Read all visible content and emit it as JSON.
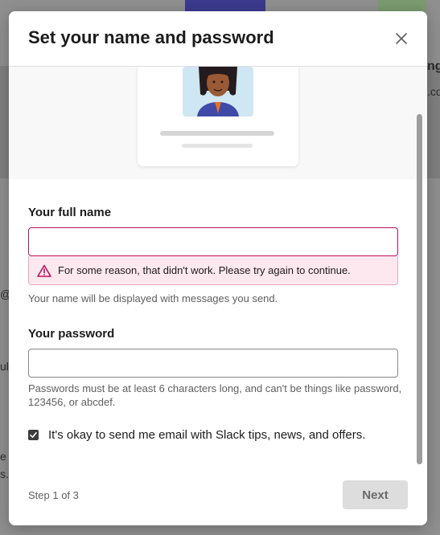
{
  "modal": {
    "title": "Set your name and password",
    "close_icon": "close-icon"
  },
  "form": {
    "full_name": {
      "label": "Your full name",
      "value": "",
      "placeholder": "",
      "error": "For some reason, that didn't work. Please try again to continue.",
      "hint": "Your name will be displayed with messages you send."
    },
    "password": {
      "label": "Your password",
      "value": "",
      "placeholder": "",
      "hint": "Passwords must be at least 6 characters long, and can't be things like password, 123456, or abcdef."
    },
    "email_opt_in": {
      "label": "It's okay to send me email with Slack tips, news, and offers.",
      "checked": true
    }
  },
  "footer": {
    "step": "Step 1 of 3",
    "next_label": "Next"
  },
  "background": {
    "frag_1": "ng",
    "frag_2": ".co",
    "frag_3": "@",
    "frag_4": "ul",
    "frag_5": "e",
    "frag_6": "s."
  },
  "colors": {
    "error_border": "#b9125d",
    "error_bg": "#fde8ef",
    "checkbox": "#3d3d3d",
    "next_disabled_bg": "#dddddd"
  }
}
